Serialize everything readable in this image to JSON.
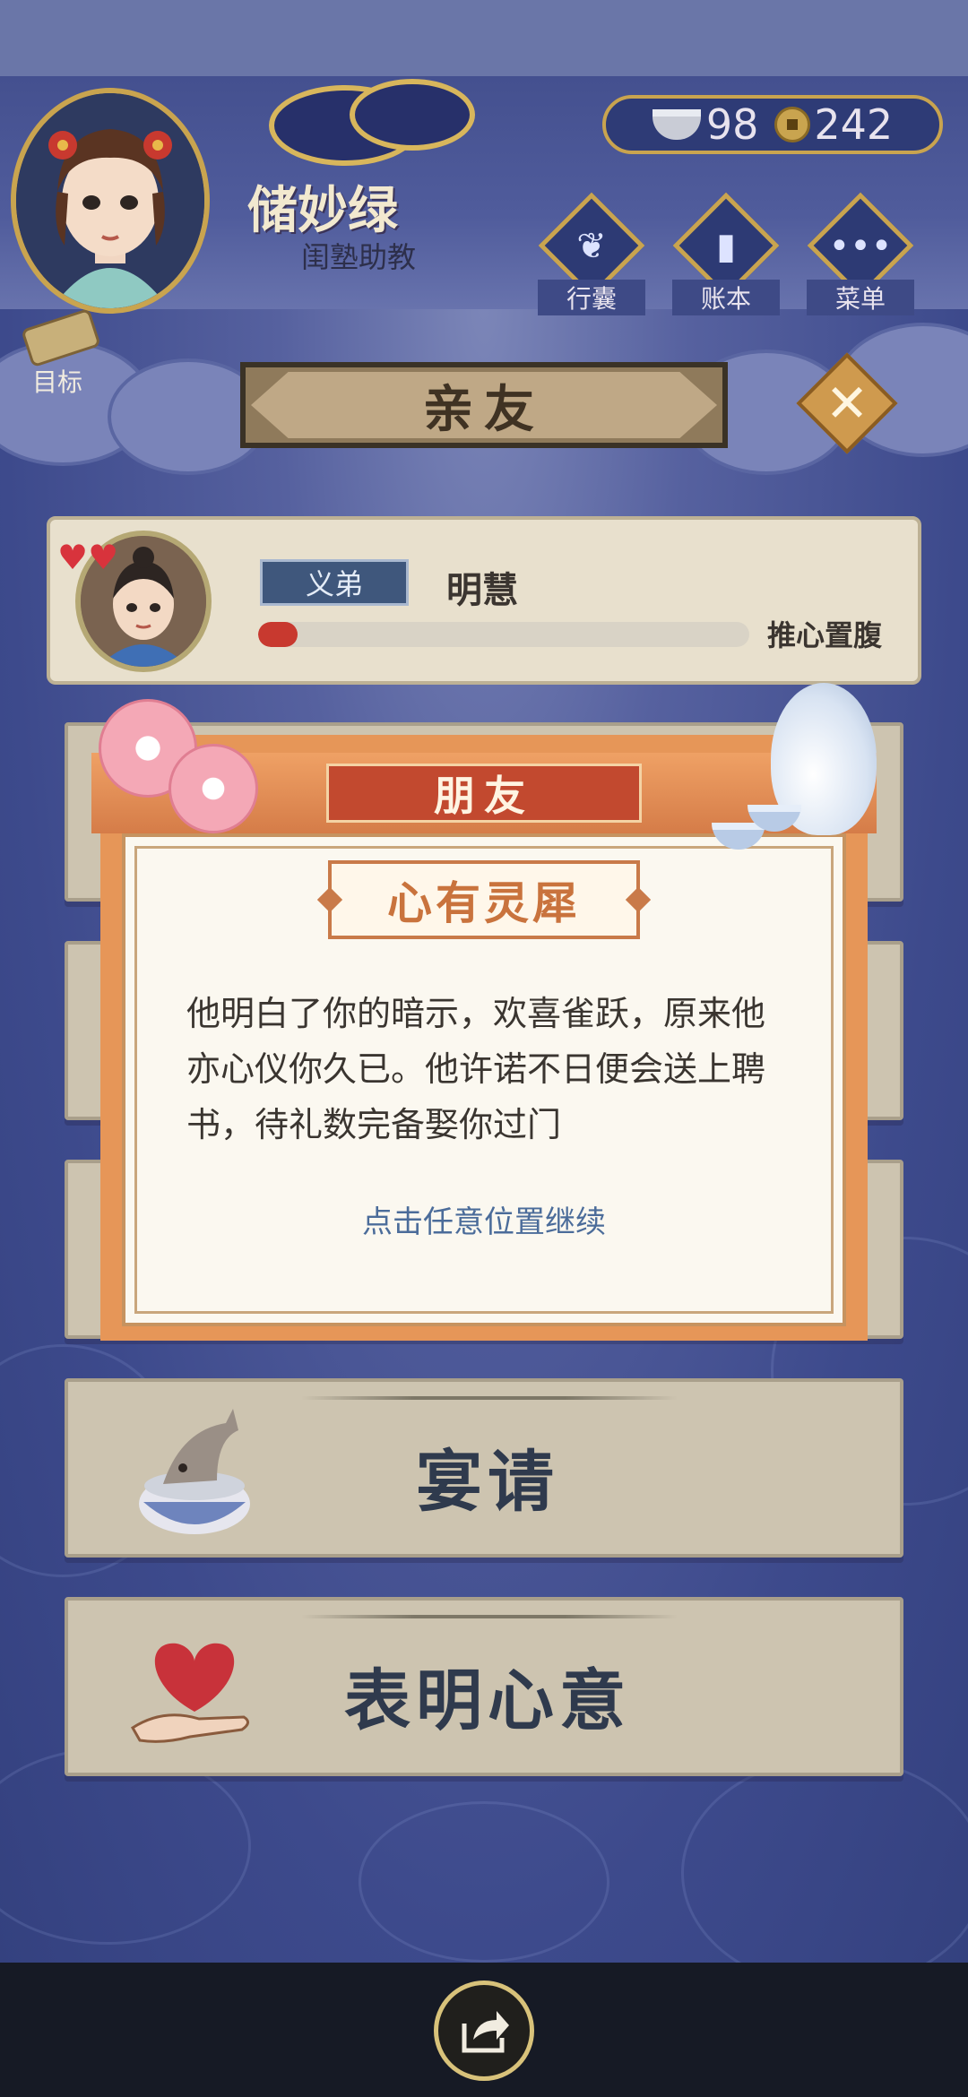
{
  "player": {
    "name": "储妙绿",
    "role": "闺塾助教"
  },
  "currency": {
    "silver": "98",
    "coins": "242"
  },
  "menu": {
    "bag_label": "行囊",
    "ledger_label": "账本",
    "menu_label": "菜单",
    "goal_label": "目标"
  },
  "page": {
    "title": "亲友"
  },
  "relation": {
    "tag": "义弟",
    "name": "明慧",
    "status": "推心置腹",
    "progress": 0.08
  },
  "actions": [
    {
      "label": "宴请",
      "icon": "fish-bowl-icon"
    },
    {
      "label": "表明心意",
      "icon": "heart-in-hand-icon"
    }
  ],
  "dialog": {
    "header": "朋友",
    "title": "心有灵犀",
    "body": "他明白了你的暗示，欢喜雀跃，原来他亦心仪你久已。他许诺不日便会送上聘书，待礼数完备娶你过门",
    "tip": "点击任意位置继续"
  },
  "colors": {
    "background": "#3f4c8e",
    "gold_border": "#c9a44f",
    "dialog_orange": "#e69658",
    "progress_red": "#c8392f"
  }
}
